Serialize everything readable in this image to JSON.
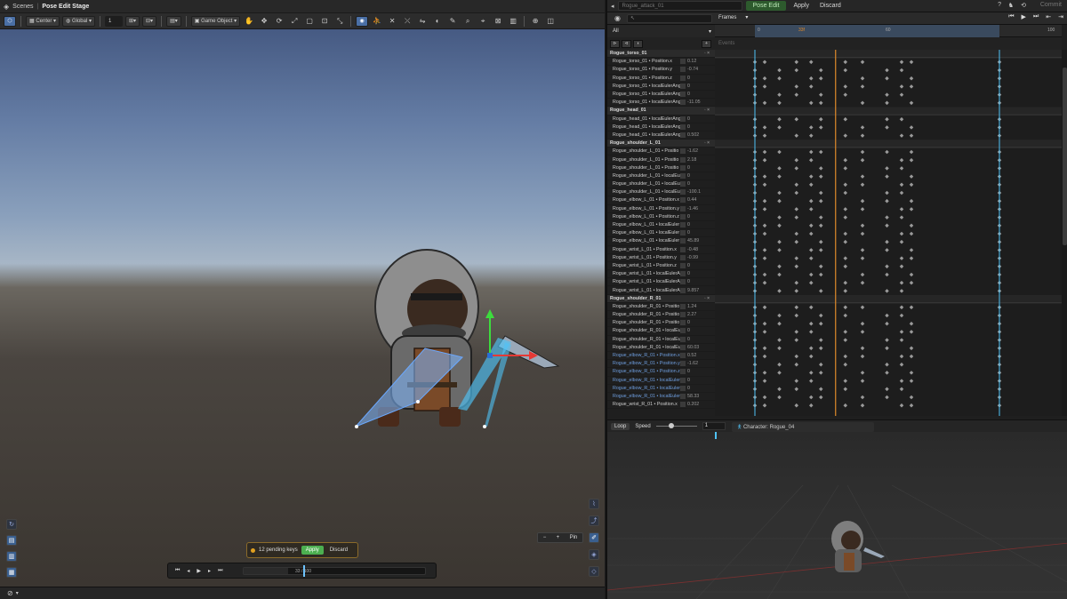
{
  "breadcrumb": {
    "scenes": "Scenes",
    "separator": "|",
    "stage": "Pose Edit Stage"
  },
  "scene_toolbar": {
    "pivot": "Center",
    "space": "Global",
    "snap_value": "1",
    "game_object": "Game Object"
  },
  "pending": {
    "text": "12 pending keys",
    "apply": "Apply",
    "discard": "Discard"
  },
  "timeline": {
    "frame_readout": "33 / 100"
  },
  "pin": {
    "minus": "−",
    "plus": "+",
    "pin": "Pin"
  },
  "anim": {
    "clip_name": "Rogue_attack_01",
    "pose_edit": "Pose Edit",
    "apply": "Apply",
    "discard": "Discard",
    "commit": "Commit",
    "help": "?",
    "search_placeholder": "",
    "frames_mode": "Frames",
    "filter": "All",
    "events_label": "Events",
    "ruler_ticks": [
      "0",
      "33f",
      "60",
      "100"
    ]
  },
  "dopesheet": {
    "playhead_frame": 33,
    "range_start": 0,
    "range_end": 100,
    "key_frames": [
      0,
      4,
      10,
      17,
      23,
      27,
      37,
      44,
      54,
      60,
      64,
      100
    ]
  },
  "properties": [
    {
      "name": "Rogue_torso_01",
      "group": true
    },
    {
      "name": "Rogue_torso_01 • Position.x",
      "value": "0.12"
    },
    {
      "name": "Rogue_torso_01 • Position.y",
      "value": "-0.74"
    },
    {
      "name": "Rogue_torso_01 • Position.z",
      "value": "0"
    },
    {
      "name": "Rogue_torso_01 • localEulerAng",
      "value": "0"
    },
    {
      "name": "Rogue_torso_01 • localEulerAng",
      "value": "0"
    },
    {
      "name": "Rogue_torso_01 • localEulerAng",
      "value": "-11.05"
    },
    {
      "name": "Rogue_head_01",
      "group": true
    },
    {
      "name": "Rogue_head_01 • localEulerAng",
      "value": "0"
    },
    {
      "name": "Rogue_head_01 • localEulerAng",
      "value": "0"
    },
    {
      "name": "Rogue_head_01 • localEulerAng",
      "value": "0.502"
    },
    {
      "name": "Rogue_shoulder_L_01",
      "group": true
    },
    {
      "name": "Rogue_shoulder_L_01 • Positio",
      "value": "-1.62"
    },
    {
      "name": "Rogue_shoulder_L_01 • Positio",
      "value": "2.18"
    },
    {
      "name": "Rogue_shoulder_L_01 • Positio",
      "value": "0"
    },
    {
      "name": "Rogue_shoulder_L_01 • localEu",
      "value": "0"
    },
    {
      "name": "Rogue_shoulder_L_01 • localEu",
      "value": "0"
    },
    {
      "name": "Rogue_shoulder_L_01 • localEu",
      "value": "-100.1"
    },
    {
      "name": "Rogue_elbow_L_01 • Position.x",
      "value": "0.44"
    },
    {
      "name": "Rogue_elbow_L_01 • Position.y",
      "value": "-1.46"
    },
    {
      "name": "Rogue_elbow_L_01 • Position.z",
      "value": "0"
    },
    {
      "name": "Rogue_elbow_L_01 • localEuler",
      "value": "0"
    },
    {
      "name": "Rogue_elbow_L_01 • localEuler",
      "value": "0"
    },
    {
      "name": "Rogue_elbow_L_01 • localEuler",
      "value": "45.89"
    },
    {
      "name": "Rogue_wrist_L_01 • Position.x",
      "value": "-0.48"
    },
    {
      "name": "Rogue_wrist_L_01 • Position.y",
      "value": "-0.99"
    },
    {
      "name": "Rogue_wrist_L_01 • Position.z",
      "value": "0"
    },
    {
      "name": "Rogue_wrist_L_01 • localEulerA",
      "value": "0"
    },
    {
      "name": "Rogue_wrist_L_01 • localEulerA",
      "value": "0"
    },
    {
      "name": "Rogue_wrist_L_01 • localEulerA",
      "value": "9.857"
    },
    {
      "name": "Rogue_shoulder_R_01",
      "group": true
    },
    {
      "name": "Rogue_shoulder_R_01 • Positio",
      "value": "1.24"
    },
    {
      "name": "Rogue_shoulder_R_01 • Positio",
      "value": "2.27"
    },
    {
      "name": "Rogue_shoulder_R_01 • Positio",
      "value": "0"
    },
    {
      "name": "Rogue_shoulder_R_01 • localEu",
      "value": "0"
    },
    {
      "name": "Rogue_shoulder_R_01 • localEu",
      "value": "0"
    },
    {
      "name": "Rogue_shoulder_R_01 • localEu",
      "value": "60.03"
    },
    {
      "name": "Rogue_elbow_R_01 • Position.x",
      "value": "0.52",
      "blue": true
    },
    {
      "name": "Rogue_elbow_R_01 • Position.y",
      "value": "-1.62",
      "blue": true
    },
    {
      "name": "Rogue_elbow_R_01 • Position.z",
      "value": "0",
      "blue": true
    },
    {
      "name": "Rogue_elbow_R_01 • localEuler",
      "value": "0",
      "blue": true
    },
    {
      "name": "Rogue_elbow_R_01 • localEuler",
      "value": "0",
      "blue": true
    },
    {
      "name": "Rogue_elbow_R_01 • localEuler",
      "value": "58.33",
      "blue": true
    },
    {
      "name": "Rogue_wrist_R_01 • Position.x",
      "value": "0.202"
    }
  ],
  "loop_bar": {
    "loop": "Loop",
    "speed": "Speed",
    "speed_value": "1",
    "character": "Character: Rogue_04"
  },
  "colors": {
    "accent_blue": "#4a6fa5",
    "playhead_orange": "#e08a2a",
    "range_cyan": "#4fc3f7",
    "pose_green": "#2d5a2d",
    "apply_green": "#4caf50"
  }
}
